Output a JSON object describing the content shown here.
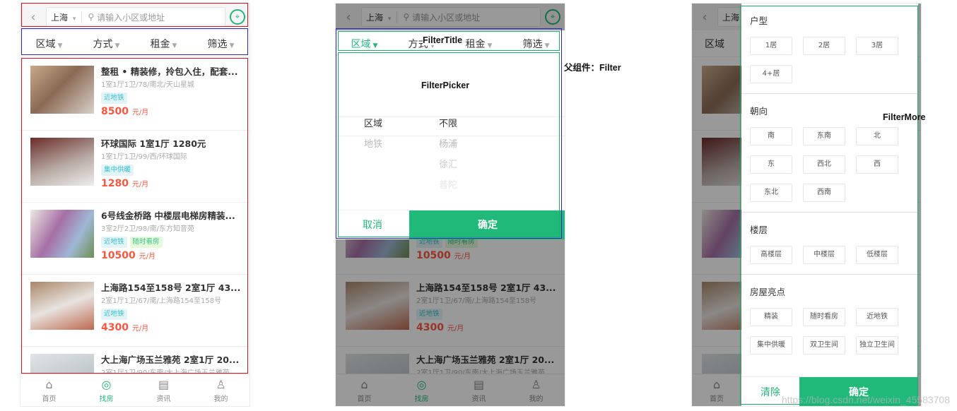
{
  "search": {
    "city": "上海",
    "placeholder": "请输入小区或地址",
    "back": "‹",
    "map_icon": "map-pin-icon"
  },
  "filters": [
    "区域",
    "方式",
    "租金",
    "筛选"
  ],
  "houses": [
    {
      "title": "整租 • 精装修，拎包入住，配套...",
      "desc": "1室1厅1卫/78/南北/天山星城",
      "tags": [
        "近地铁"
      ],
      "price": "8500",
      "unit": "元/月"
    },
    {
      "title": "环球国际 1室1厅 1280元",
      "desc": "1室1厅1卫/99/西/环球国际",
      "tags": [
        "集中供暖"
      ],
      "price": "1280",
      "unit": "元/月"
    },
    {
      "title": "6号线金桥路 中楼层电梯房精装...",
      "desc": "3室2厅2卫/98/南/东方知音苑",
      "tags": [
        "近地铁",
        "随时看房"
      ],
      "price": "10500",
      "unit": "元/月"
    },
    {
      "title": "上海路154至158号 2室1厅 43...",
      "desc": "2室1厅1卫/67/南/上海路154至158号",
      "tags": [
        "近地铁"
      ],
      "price": "4300",
      "unit": "元/月"
    },
    {
      "title": "大上海广场玉兰雅苑 2室1厅 20...",
      "desc": "2室1厅1卫/90/东南/大上海广场玉兰雅苑",
      "tags": [],
      "price": "",
      "unit": ""
    }
  ],
  "tabbar": [
    {
      "label": "首页",
      "icon": "home-icon"
    },
    {
      "label": "找房",
      "icon": "search-house-icon"
    },
    {
      "label": "资讯",
      "icon": "news-icon"
    },
    {
      "label": "我的",
      "icon": "user-icon"
    }
  ],
  "notes": {
    "filter_title": "FilterTitle",
    "filter_picker": "FilterPicker",
    "parent": "父组件：Filter",
    "filter_more": "FilterMore"
  },
  "picker": {
    "col1": [
      "区域",
      "地铁"
    ],
    "col2": [
      "不限",
      "杨浦",
      "徐汇",
      "普陀"
    ],
    "cancel": "取消",
    "ok": "确定"
  },
  "more": {
    "sections": [
      {
        "title": "户型",
        "options": [
          "1居",
          "2居",
          "3居",
          "4+居"
        ]
      },
      {
        "title": "朝向",
        "options": [
          "南",
          "东南",
          "北",
          "东",
          "西北",
          "西",
          "东北",
          "西南"
        ]
      },
      {
        "title": "楼层",
        "options": [
          "高楼层",
          "中楼层",
          "低楼层"
        ]
      },
      {
        "title": "房屋亮点",
        "options": [
          "精装",
          "随时看房",
          "近地铁",
          "集中供暖",
          "双卫生间",
          "独立卫生间"
        ]
      }
    ],
    "clear": "清除",
    "ok": "确定"
  },
  "watermark": "https://blog.csdn.net/weixin_45583708",
  "colors": {
    "accent": "#21b97a",
    "price": "#fa5741",
    "annot_red": "#e00d1e",
    "annot_blue": "#2626c8",
    "annot_green": "#16b06a"
  }
}
